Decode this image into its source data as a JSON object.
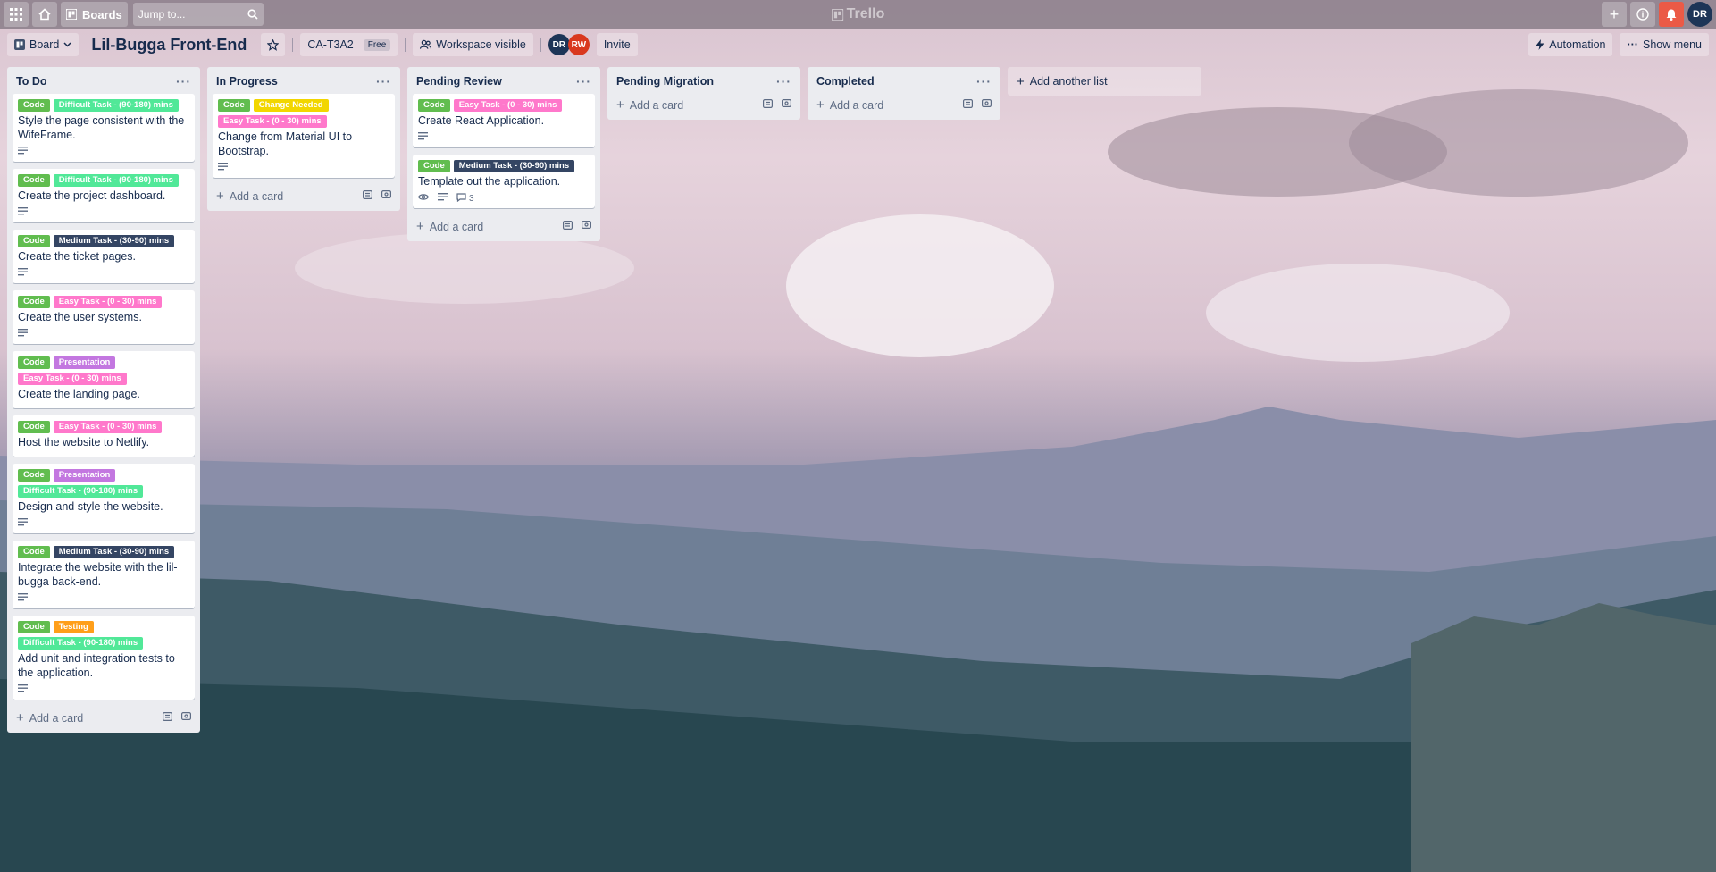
{
  "topbar": {
    "apps_icon": "grid-icon",
    "home_icon": "home-icon",
    "boards_label": "Boards",
    "search_placeholder": "Jump to...",
    "logo": "Trello",
    "avatar": "DR"
  },
  "board": {
    "view_label": "Board",
    "title": "Lil-Bugga Front-End",
    "workspace": "CA-T3A2",
    "plan": "Free",
    "visibility": "Workspace visible",
    "members": [
      "DR",
      "RW"
    ],
    "invite_label": "Invite",
    "automation_label": "Automation",
    "show_menu_label": "Show menu"
  },
  "colors": {
    "green": "#61bd4f",
    "mint": "#51e898",
    "pink": "#ff78cb",
    "navy": "#344563",
    "yellow": "#f2d600",
    "purple": "#c377e0",
    "orange": "#ff9f1a"
  },
  "add_card_label": "Add a card",
  "add_list_label": "Add another list",
  "lists": [
    {
      "name": "To Do",
      "cards": [
        {
          "labels": [
            [
              "Code",
              "green"
            ],
            [
              "Difficult Task - (90-180) mins",
              "mint"
            ]
          ],
          "title": "Style the page consistent with the WifeFrame.",
          "desc": true
        },
        {
          "labels": [
            [
              "Code",
              "green"
            ],
            [
              "Difficult Task - (90-180) mins",
              "mint"
            ]
          ],
          "title": "Create the project dashboard.",
          "desc": true
        },
        {
          "labels": [
            [
              "Code",
              "green"
            ],
            [
              "Medium Task - (30-90) mins",
              "navy"
            ]
          ],
          "title": "Create the ticket pages.",
          "desc": true
        },
        {
          "labels": [
            [
              "Code",
              "green"
            ],
            [
              "Easy Task - (0 - 30) mins",
              "pink"
            ]
          ],
          "title": "Create the user systems.",
          "desc": true
        },
        {
          "labels": [
            [
              "Code",
              "green"
            ],
            [
              "Presentation",
              "purple"
            ],
            [
              "Easy Task - (0 - 30) mins",
              "pink"
            ]
          ],
          "title": "Create the landing page.",
          "desc": false
        },
        {
          "labels": [
            [
              "Code",
              "green"
            ],
            [
              "Easy Task - (0 - 30) mins",
              "pink"
            ]
          ],
          "title": "Host the website to Netlify.",
          "desc": false
        },
        {
          "labels": [
            [
              "Code",
              "green"
            ],
            [
              "Presentation",
              "purple"
            ],
            [
              "Difficult Task - (90-180) mins",
              "mint"
            ]
          ],
          "title": "Design and style the website.",
          "desc": true
        },
        {
          "labels": [
            [
              "Code",
              "green"
            ],
            [
              "Medium Task - (30-90) mins",
              "navy"
            ]
          ],
          "title": "Integrate the website with the lil-bugga back-end.",
          "desc": true
        },
        {
          "labels": [
            [
              "Code",
              "green"
            ],
            [
              "Testing",
              "orange"
            ],
            [
              "Difficult Task - (90-180) mins",
              "mint"
            ]
          ],
          "title": "Add unit and integration tests to the application.",
          "desc": true
        }
      ]
    },
    {
      "name": "In Progress",
      "cards": [
        {
          "labels": [
            [
              "Code",
              "green"
            ],
            [
              "Change Needed",
              "yellow"
            ],
            [
              "Easy Task - (0 - 30) mins",
              "pink"
            ]
          ],
          "title": "Change from Material UI to Bootstrap.",
          "desc": true
        }
      ]
    },
    {
      "name": "Pending Review",
      "cards": [
        {
          "labels": [
            [
              "Code",
              "green"
            ],
            [
              "Easy Task - (0 - 30) mins",
              "pink"
            ]
          ],
          "title": "Create React Application.",
          "desc": true
        },
        {
          "labels": [
            [
              "Code",
              "green"
            ],
            [
              "Medium Task - (30-90) mins",
              "navy"
            ]
          ],
          "title": "Template out the application.",
          "desc": true,
          "watch": true,
          "comments": "3"
        }
      ]
    },
    {
      "name": "Pending Migration",
      "cards": []
    },
    {
      "name": "Completed",
      "cards": []
    }
  ]
}
